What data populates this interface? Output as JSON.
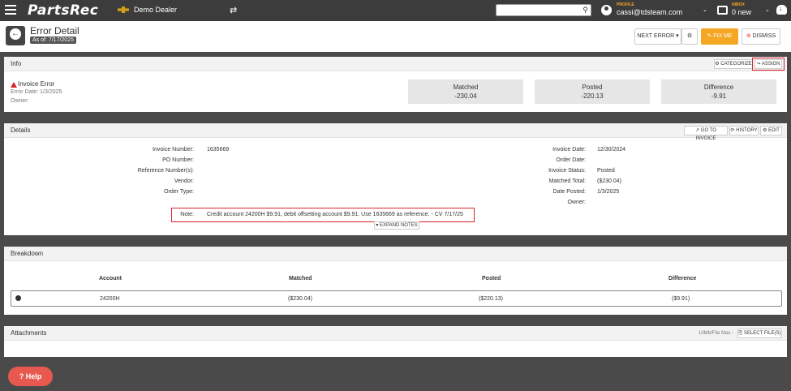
{
  "topbar": {
    "logo": "PartsRec",
    "dealer": "Demo Dealer",
    "search_placeholder": "",
    "profile_label": "PROFILE",
    "profile_email": "cassi@tdsteam.com",
    "inbox_label": "INBOX",
    "inbox_count": "0 new"
  },
  "header": {
    "title": "Error Detail",
    "as_of": "As of: 7/17/2025",
    "next_error": "NEXT ERROR ▾",
    "gear": "⚙",
    "fix_me": "✎ FIX ME",
    "dismiss": "DISMISS"
  },
  "info": {
    "title": "Info",
    "categorize": "⚙ CATEGORIZE",
    "assign": "↪ ASSIGN",
    "error_type": "Invoice Error",
    "error_date": "Error Date: 1/3/2025",
    "owner": "Owner:",
    "summary": [
      {
        "label": "Matched",
        "value": "-230.04"
      },
      {
        "label": "Posted",
        "value": "-220.13"
      },
      {
        "label": "Difference",
        "value": "-9.91"
      }
    ]
  },
  "details": {
    "title": "Details",
    "go_to_invoice": "↗ GO TO INVOICE",
    "history": "⟳ HISTORY",
    "edit": "⚙ EDIT",
    "left": [
      {
        "label": "Invoice Number:",
        "value": "1635669"
      },
      {
        "label": "PO Number:",
        "value": ""
      },
      {
        "label": "Reference Number(s):",
        "value": ""
      },
      {
        "label": "Vendor:",
        "value": ""
      },
      {
        "label": "Order Type:",
        "value": ""
      }
    ],
    "right": [
      {
        "label": "Invoice Date:",
        "value": "12/30/2024"
      },
      {
        "label": "Order Date:",
        "value": ""
      },
      {
        "label": "Invoice Status:",
        "value": "Posted"
      },
      {
        "label": "Matched Total:",
        "value": "($230.04)"
      },
      {
        "label": "Date Posted:",
        "value": "1/3/2025"
      },
      {
        "label": "Owner:",
        "value": ""
      }
    ],
    "note_label": "Note:",
    "note_text": "Credit account 24200H $9.91, debit offsetting account $9.91. Use 1635669 as reference. - CV 7/17/25",
    "expand_notes": "▾ EXPAND NOTES"
  },
  "breakdown": {
    "title": "Breakdown",
    "headers": [
      "Account",
      "Matched",
      "Posted",
      "Difference"
    ],
    "rows": [
      {
        "account": "24200H",
        "matched": "($230.04)",
        "posted": "($220.13)",
        "difference": "($9.91)"
      }
    ]
  },
  "attachments": {
    "title": "Attachments",
    "limit": "10Mb/File Max -",
    "select": "⎘ SELECT FILE(S)"
  },
  "help": "? Help",
  "colors": {
    "accent": "#f5a623",
    "highlight": "#d9232a",
    "topbar": "#3c3c3c"
  }
}
